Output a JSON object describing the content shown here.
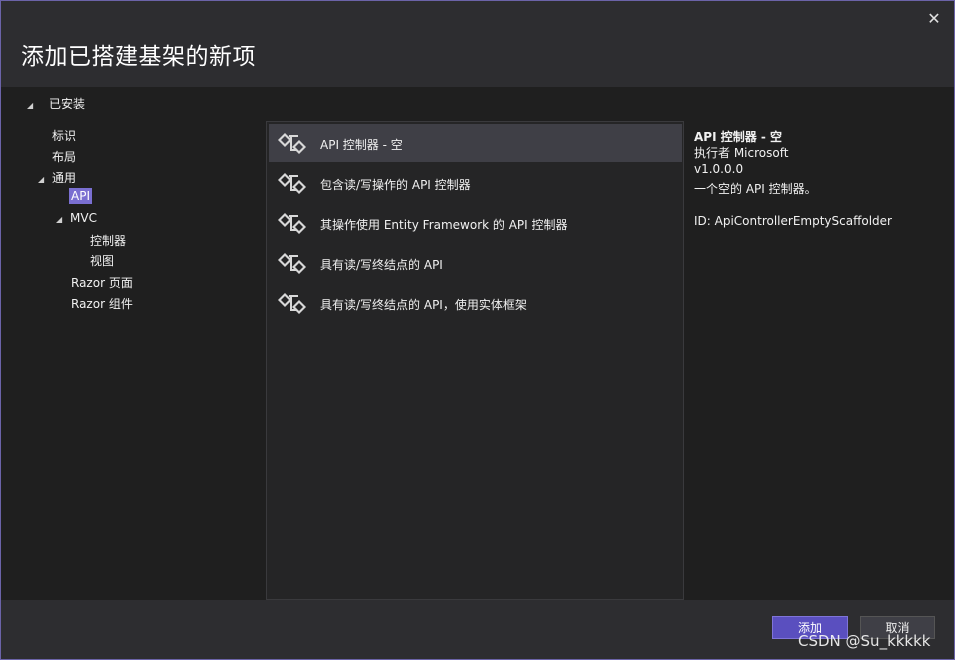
{
  "dialog": {
    "title": "添加已搭建基架的新项",
    "close_icon": "close-icon"
  },
  "tree": {
    "root_label": "已安装",
    "items": [
      {
        "label": "标识"
      },
      {
        "label": "布局"
      },
      {
        "label": "通用"
      },
      {
        "label": "API"
      },
      {
        "label": "MVC"
      },
      {
        "label": "控制器"
      },
      {
        "label": "视图"
      },
      {
        "label": "Razor 页面"
      },
      {
        "label": "Razor 组件"
      }
    ]
  },
  "templates": [
    {
      "label": "API 控制器 - 空"
    },
    {
      "label": "包含读/写操作的 API 控制器"
    },
    {
      "label": "其操作使用 Entity Framework 的 API 控制器"
    },
    {
      "label": "具有读/写终结点的 API"
    },
    {
      "label": "具有读/写终结点的 API，使用实体框架"
    }
  ],
  "details": {
    "title": "API 控制器 - 空",
    "author": "执行者 Microsoft",
    "version": "v1.0.0.0",
    "description": "一个空的 API 控制器。",
    "id": "ID: ApiControllerEmptyScaffolder"
  },
  "footer": {
    "add_label": "添加",
    "cancel_label": "取消"
  },
  "watermark": "CSDN @Su_kkkkk",
  "colors": {
    "accent": "#5a4fbf",
    "selection": "#7a6fd1",
    "background": "#1f1f1f"
  }
}
